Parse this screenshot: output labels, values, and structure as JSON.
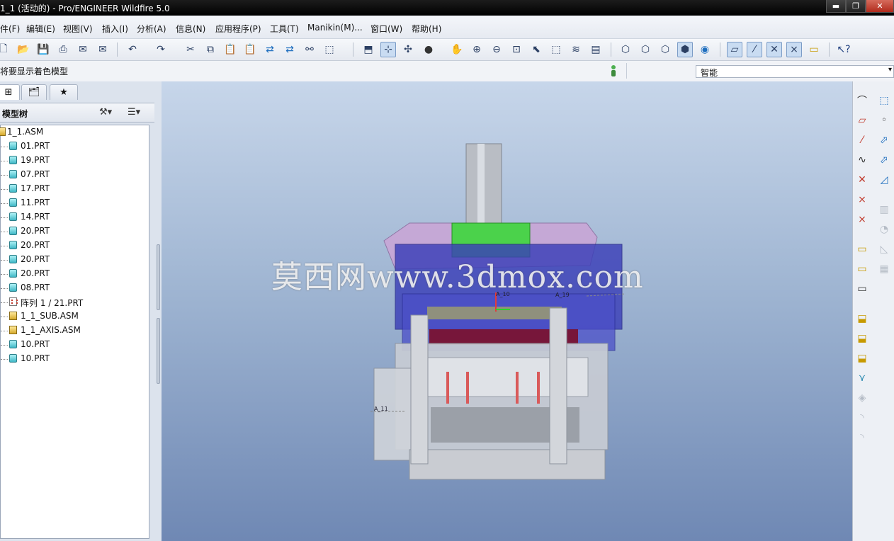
{
  "window": {
    "title": "1_1 (活动的) - Pro/ENGINEER Wildfire 5.0",
    "controls": [
      "▬",
      "❐",
      "✕"
    ]
  },
  "menu": [
    "件(F)",
    "编辑(E)",
    "视图(V)",
    "插入(I)",
    "分析(A)",
    "信息(N)",
    "应用程序(P)",
    "工具(T)",
    "Manikin(M)...",
    "窗口(W)",
    "帮助(H)"
  ],
  "toolbar": {
    "icons": [
      "new-icon",
      "open-icon",
      "save-icon",
      "print-icon",
      "send-mail-icon",
      "email-icon",
      "undo-icon",
      "redo-icon",
      "cut-icon",
      "copy-icon",
      "paste-icon",
      "paste-special-icon",
      "regenerate-icon",
      "regen-manager-icon",
      "find-icon",
      "select-box-icon",
      "repaint-icon",
      "orient-icon",
      "spin-center-icon",
      "shading-icon",
      "pan-icon",
      "zoom-in-icon",
      "zoom-out-icon",
      "refit-icon",
      "reorient-icon",
      "saved-views-icon",
      "layers-icon",
      "view-manager-icon",
      "wireframe-icon",
      "hidden-line-icon",
      "no-hidden-icon",
      "shaded-icon",
      "enhanced-realism-icon",
      "datum-planes-icon",
      "datum-axes-icon",
      "point-icon",
      "csys-icon",
      "annotation-icon",
      "context-help-icon"
    ]
  },
  "status": {
    "message": "将要显示着色模型",
    "filter_value": "智能"
  },
  "panel": {
    "tree_title": "模型树",
    "items": [
      {
        "label": "1_1.ASM",
        "type": "asm"
      },
      {
        "label": "01.PRT",
        "type": "prt"
      },
      {
        "label": "19.PRT",
        "type": "prt"
      },
      {
        "label": "07.PRT",
        "type": "prt"
      },
      {
        "label": "17.PRT",
        "type": "prt"
      },
      {
        "label": "11.PRT",
        "type": "prt"
      },
      {
        "label": "14.PRT",
        "type": "prt"
      },
      {
        "label": "20.PRT",
        "type": "prt"
      },
      {
        "label": "20.PRT",
        "type": "prt"
      },
      {
        "label": "20.PRT",
        "type": "prt"
      },
      {
        "label": "20.PRT",
        "type": "prt"
      },
      {
        "label": "08.PRT",
        "type": "prt"
      },
      {
        "label": "阵列 1 / 21.PRT",
        "type": "pattern"
      },
      {
        "label": "1_1_SUB.ASM",
        "type": "asm"
      },
      {
        "label": "1_1_AXIS.ASM",
        "type": "asm"
      },
      {
        "label": "10.PRT",
        "type": "prt"
      },
      {
        "label": "10.PRT",
        "type": "prt"
      }
    ]
  },
  "viewport": {
    "watermark": "莫西网www.3dmox.com",
    "datum_tags": [
      "A_10",
      "A_19",
      "A_11"
    ]
  }
}
